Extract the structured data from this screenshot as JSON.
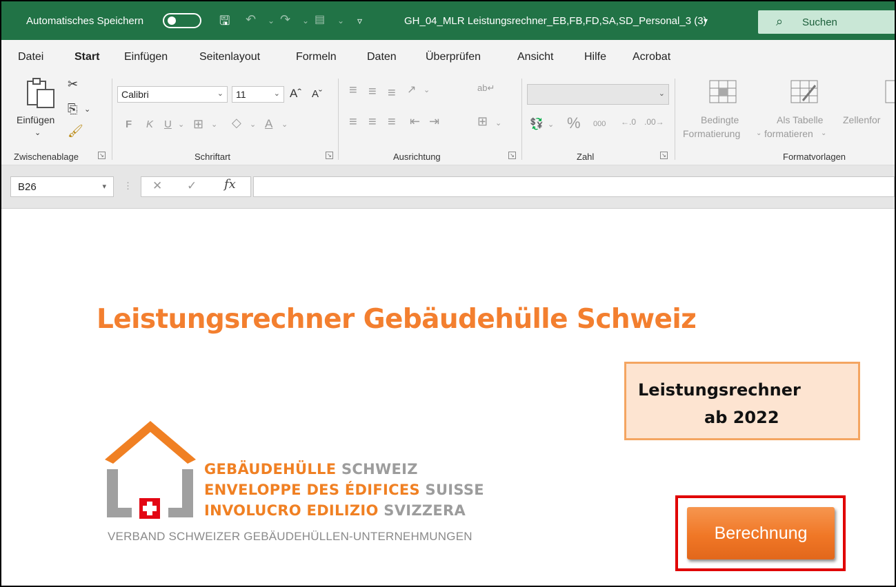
{
  "titlebar": {
    "autosave_label": "Automatisches Speichern",
    "document_name": "GH_04_MLR Leistungsrechner_EB,FB,FD,SA,SD_Personal_3 (3)",
    "search_label": "Suchen"
  },
  "tabs": [
    "Datei",
    "Start",
    "Einfügen",
    "Seitenlayout",
    "Formeln",
    "Daten",
    "Überprüfen",
    "Ansicht",
    "Hilfe",
    "Acrobat"
  ],
  "active_tab": "Start",
  "ribbon": {
    "clipboard": {
      "paste_label": "Einfügen",
      "group_label": "Zwischenablage"
    },
    "font": {
      "font_name": "Calibri",
      "font_size": "11",
      "bold": "F",
      "italic": "K",
      "underline": "U",
      "group_label": "Schriftart"
    },
    "alignment": {
      "group_label": "Ausrichtung"
    },
    "number": {
      "group_label": "Zahl"
    },
    "styles": {
      "conditional_line1": "Bedingte",
      "conditional_line2": "Formatierung",
      "table_line1": "Als Tabelle",
      "table_line2": "formatieren",
      "cell_styles": "Zellenfor",
      "group_label": "Formatvorlagen"
    }
  },
  "formula_bar": {
    "cell_ref": "B26",
    "formula": "",
    "fx_label": "fx"
  },
  "sheet": {
    "title": "Leistungsrechner Gebäudehülle Schweiz",
    "info_line1": "Leistungsrechner",
    "info_line2": "ab 2022",
    "button_label": "Berechnung",
    "logo": {
      "line1_orange": "GEBÄUDEHÜLLE",
      "line1_gray": "SCHWEIZ",
      "line2_orange": "ENVELOPPE DES ÉDIFICES",
      "line2_gray": "SUISSE",
      "line3_orange": "INVOLUCRO EDILIZIO",
      "line3_gray": "SVIZZERA",
      "association": "VERBAND SCHWEIZER GEBÄUDEHÜLLEN-UNTERNEHMUNGEN"
    }
  },
  "colors": {
    "excel_green": "#217346",
    "title_orange": "#f37f2f",
    "highlight_red": "#e00000",
    "info_box_bg": "#fde4d1"
  }
}
